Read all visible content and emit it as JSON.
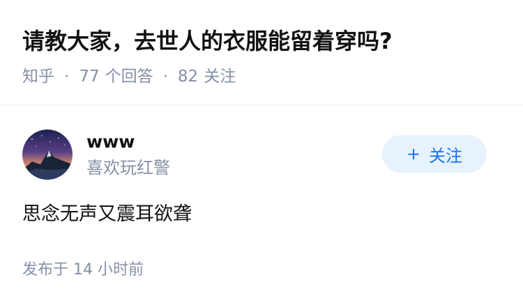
{
  "question": {
    "title": "请教大家，去世人的衣服能留着穿吗?",
    "source": "知乎",
    "separator": "·",
    "answers_count": "77",
    "answers_label": "个回答",
    "followers_count": "82",
    "followers_label": "关注"
  },
  "answer": {
    "author": {
      "name": "www",
      "bio": "喜欢玩红警",
      "avatar_icon": "mountain-night-sky-avatar"
    },
    "follow_button": {
      "icon": "+",
      "label": "关注"
    },
    "content": "思念无声又震耳欲聋",
    "published_label": "发布于",
    "published_time": "14 小时前"
  },
  "colors": {
    "primary_text": "#121212",
    "secondary_text": "#8590a6",
    "accent": "#1772f6",
    "follow_bg": "#e8f2fd"
  }
}
